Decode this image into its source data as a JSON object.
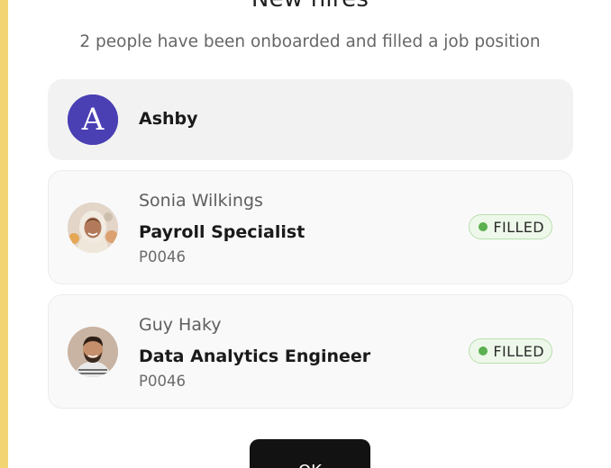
{
  "modal": {
    "title": "New hires",
    "subtitle": "2 people have been onboarded and filled a job position"
  },
  "company": {
    "name": "Ashby",
    "logo_icon": "ashby-logo-icon",
    "logo_letter": "A",
    "logo_color": "#4a3fb3"
  },
  "hires": [
    {
      "name": "Sonia Wilkings",
      "role": "Payroll Specialist",
      "code": "P0046",
      "status": "FILLED",
      "avatar_icon": "woman-headscarf-avatar"
    },
    {
      "name": "Guy Haky",
      "role": "Data Analytics Engineer",
      "code": "P0046",
      "status": "FILLED",
      "avatar_icon": "man-beard-avatar"
    }
  ],
  "colors": {
    "accent_bar": "#f2d472",
    "status_filled_dot": "#5cb04f",
    "status_filled_bg": "#eef8ea",
    "button_bg": "#121212"
  },
  "actions": {
    "ok_label": "OK"
  }
}
